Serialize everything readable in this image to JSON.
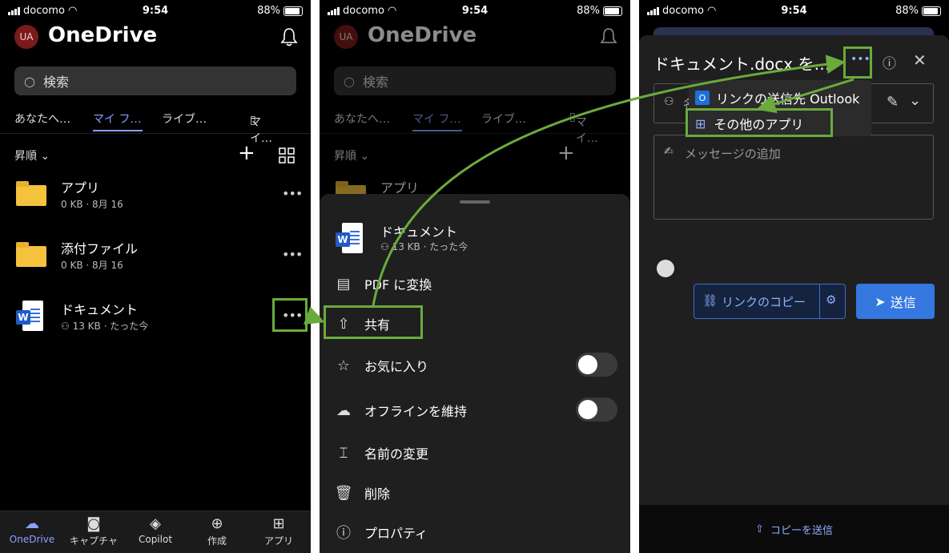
{
  "status": {
    "carrier": "docomo",
    "time": "9:54",
    "battery": "88%"
  },
  "app": {
    "title": "OneDrive",
    "avatar_initials": "UA"
  },
  "search": {
    "placeholder": "検索"
  },
  "tabs": [
    "あなたへ…",
    "マイ フ…",
    "ライブ…",
    "マイ…"
  ],
  "sort": {
    "label": "昇順"
  },
  "files": [
    {
      "name": "アプリ",
      "meta": "0 KB · 8月 16",
      "type": "folder"
    },
    {
      "name": "添付ファイル",
      "meta": "0 KB · 8月 16",
      "type": "folder"
    },
    {
      "name": "ドキュメント",
      "meta": "13 KB · たった今",
      "type": "word"
    }
  ],
  "nav": [
    {
      "label": "OneDrive",
      "icon": "cloud-icon"
    },
    {
      "label": "キャプチャ",
      "icon": "camera-icon"
    },
    {
      "label": "Copilot",
      "icon": "copilot-icon"
    },
    {
      "label": "作成",
      "icon": "plus-circle-icon"
    },
    {
      "label": "アプリ",
      "icon": "apps-icon"
    }
  ],
  "sheet": {
    "file_name": "ドキュメント",
    "file_meta": "13 KB · たった今",
    "items": [
      {
        "label": "PDF に変換",
        "icon": "pdf-icon"
      },
      {
        "label": "共有",
        "icon": "share-icon"
      },
      {
        "label": "お気に入り",
        "icon": "star-icon",
        "toggle": false
      },
      {
        "label": "オフラインを維持",
        "icon": "offline-icon",
        "toggle": false
      },
      {
        "label": "名前の変更",
        "icon": "rename-icon"
      },
      {
        "label": "削除",
        "icon": "trash-icon"
      },
      {
        "label": "プロパティ",
        "icon": "info-icon"
      }
    ]
  },
  "share": {
    "title": "ドキュメント.docx を…",
    "name_placeholder": "名",
    "message_placeholder": "メッセージの追加",
    "menu": [
      "リンクの送信先 Outlook",
      "その他のアプリ"
    ],
    "copy_link": "リンクのコピー",
    "send": "送信",
    "send_copy": "コピーを送信"
  },
  "colors": {
    "accent": "#8aa0ff",
    "highlight": "#6aab3c",
    "send_button": "#3478e0"
  }
}
